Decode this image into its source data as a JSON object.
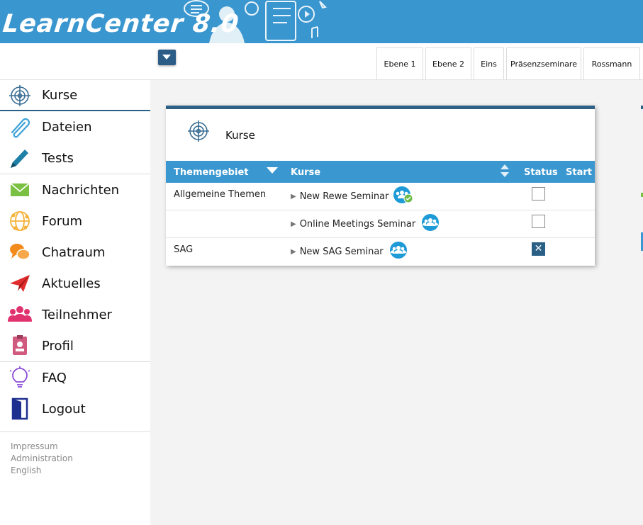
{
  "app": {
    "title": "LearnCenter 8.0"
  },
  "tabs": [
    "Ebene 1",
    "Ebene 2",
    "Eins",
    "Präsenzseminare",
    "Rossmann"
  ],
  "sidebar": {
    "items": [
      {
        "label": "Kurse",
        "icon": "target-icon"
      },
      {
        "label": "Dateien",
        "icon": "paperclip-icon"
      },
      {
        "label": "Tests",
        "icon": "pencil-icon"
      },
      {
        "label": "Nachrichten",
        "icon": "envelope-icon"
      },
      {
        "label": "Forum",
        "icon": "forum-icon"
      },
      {
        "label": "Chatraum",
        "icon": "chat-icon"
      },
      {
        "label": "Aktuelles",
        "icon": "paper-plane-icon"
      },
      {
        "label": "Teilnehmer",
        "icon": "people-icon"
      },
      {
        "label": "Profil",
        "icon": "badge-icon"
      },
      {
        "label": "FAQ",
        "icon": "lightbulb-icon"
      },
      {
        "label": "Logout",
        "icon": "door-icon"
      }
    ],
    "footer": [
      "Impressum",
      "Administration",
      "English"
    ]
  },
  "panel": {
    "title": "Kurse",
    "columns": [
      "Themengebiet",
      "Kurse",
      "Status",
      "Start"
    ],
    "rows": [
      {
        "topic": "Allgemeine Themen",
        "course": "New Rewe Seminar",
        "status": "unchecked",
        "icon": "group-check-icon"
      },
      {
        "topic": "",
        "course": "Online Meetings Seminar",
        "status": "unchecked",
        "icon": "group-icon"
      },
      {
        "topic": "SAG",
        "course": "New SAG Seminar",
        "status": "checked",
        "icon": "group-icon"
      }
    ]
  },
  "colors": {
    "header": "#3a96cf",
    "accent": "#2a5f86",
    "table_header": "#3b97d0"
  }
}
